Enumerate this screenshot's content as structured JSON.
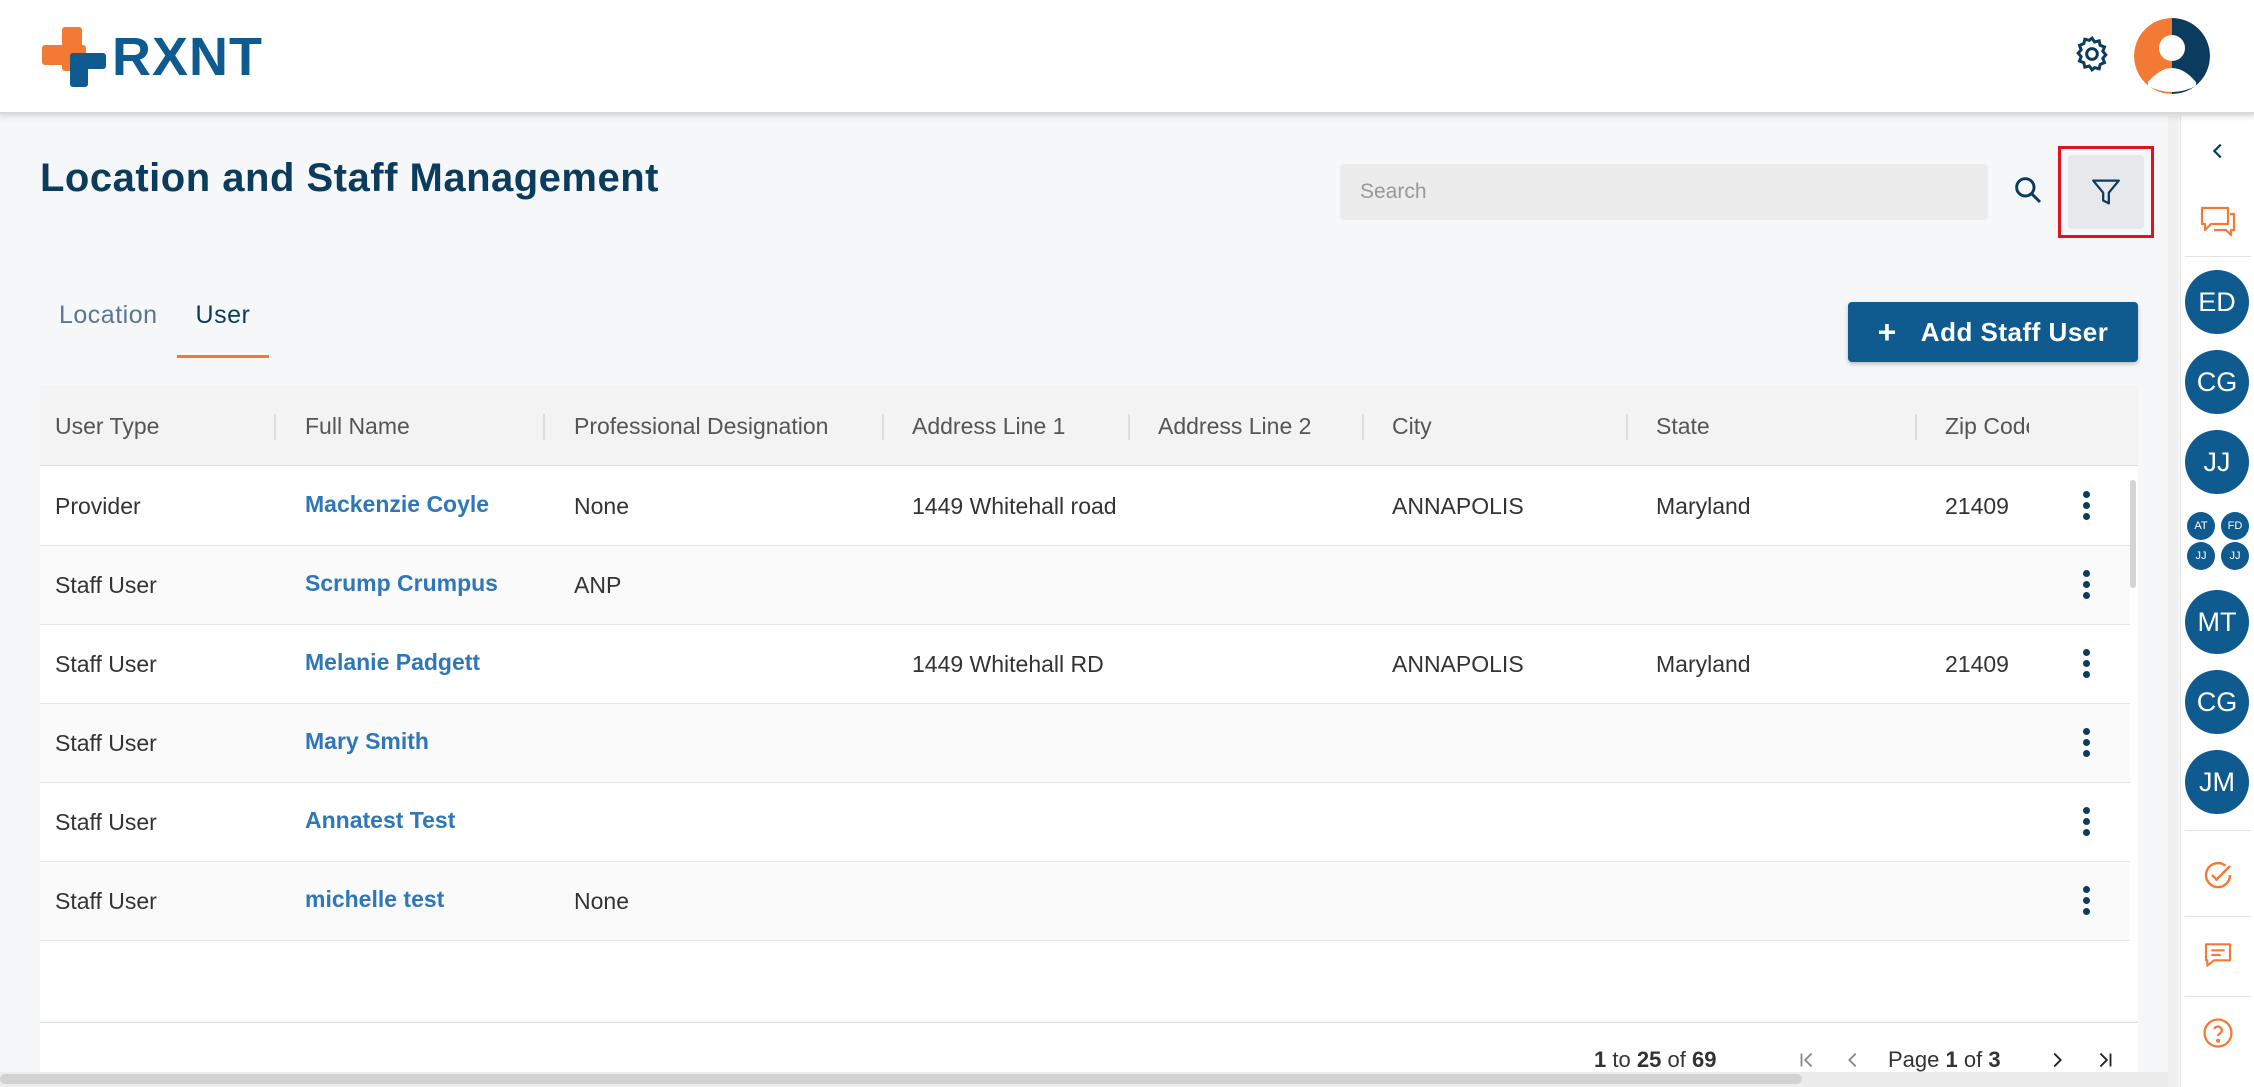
{
  "header": {
    "brand": "RXNT",
    "settings_icon": "gear-icon",
    "avatar_icon": "user-avatar-icon"
  },
  "page": {
    "title": "Location and Staff Management",
    "search_placeholder": "Search",
    "add_button_label": "Add Staff User",
    "add_button_icon": "+"
  },
  "tabs": [
    {
      "label": "Location",
      "active": false
    },
    {
      "label": "User",
      "active": true
    }
  ],
  "table": {
    "columns": [
      "User Type",
      "Full Name",
      "Professional Designation",
      "Address Line 1",
      "Address Line 2",
      "City",
      "State",
      "Zip Code"
    ],
    "rows": [
      {
        "user_type": "Provider",
        "full_name": "Mackenzie Coyle",
        "designation": "None",
        "address1": "1449 Whitehall road",
        "address2": "",
        "city": "ANNAPOLIS",
        "state": "Maryland",
        "zip": "21409"
      },
      {
        "user_type": "Staff User",
        "full_name": "Scrump Crumpus",
        "designation": "ANP",
        "address1": "",
        "address2": "",
        "city": "",
        "state": "",
        "zip": ""
      },
      {
        "user_type": "Staff User",
        "full_name": "Melanie Padgett",
        "designation": "",
        "address1": "1449 Whitehall RD",
        "address2": "",
        "city": "ANNAPOLIS",
        "state": "Maryland",
        "zip": "21409"
      },
      {
        "user_type": "Staff User",
        "full_name": "Mary Smith",
        "designation": "",
        "address1": "",
        "address2": "",
        "city": "",
        "state": "",
        "zip": ""
      },
      {
        "user_type": "Staff User",
        "full_name": "Annatest Test",
        "designation": "",
        "address1": "",
        "address2": "",
        "city": "",
        "state": "",
        "zip": ""
      },
      {
        "user_type": "Staff User",
        "full_name": "michelle test",
        "designation": "None",
        "address1": "",
        "address2": "",
        "city": "",
        "state": "",
        "zip": ""
      }
    ]
  },
  "pager": {
    "from": "1",
    "to_word": "to",
    "to": "25",
    "of_word": "of",
    "total": "69",
    "page_word": "Page",
    "page": "1",
    "page_of_word": "of",
    "pages": "3"
  },
  "rail": {
    "avatars": [
      "ED",
      "CG",
      "JJ",
      "MT",
      "CG",
      "JM"
    ],
    "group_avatars": [
      "AT",
      "FD",
      "JJ",
      "JJ"
    ]
  },
  "colors": {
    "brand_blue": "#0f5a8e",
    "brand_orange": "#f27a35",
    "link_blue": "#2f77b6",
    "highlight_red": "#e0141e"
  }
}
